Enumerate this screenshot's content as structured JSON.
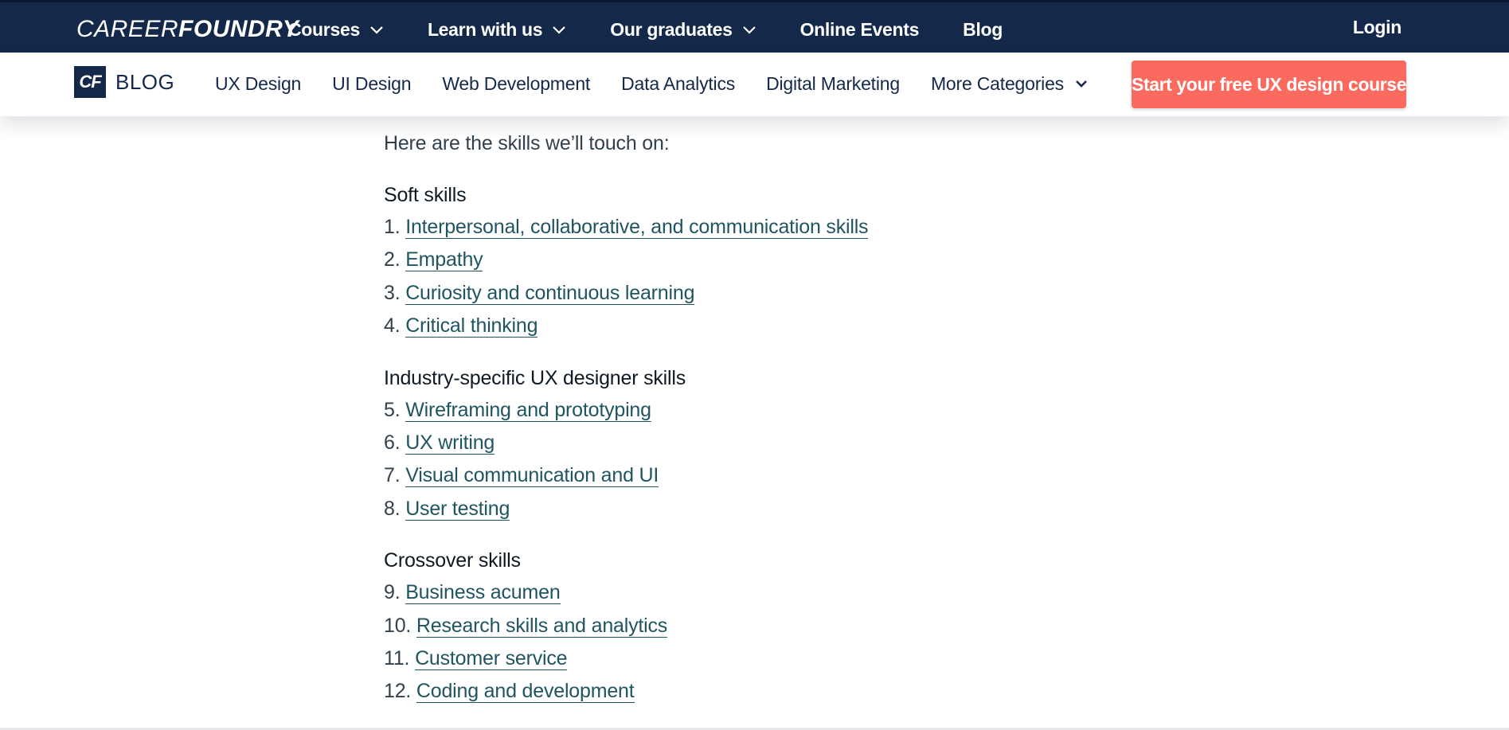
{
  "topbar": {
    "logo_part1": "CAREER",
    "logo_part2": "FOUNDRY",
    "nav": [
      {
        "label": "Courses",
        "dropdown": true
      },
      {
        "label": "Learn with us",
        "dropdown": true
      },
      {
        "label": "Our graduates",
        "dropdown": true
      },
      {
        "label": "Online Events",
        "dropdown": false
      },
      {
        "label": "Blog",
        "dropdown": false
      }
    ],
    "login": "Login"
  },
  "subbar": {
    "badge": "CF",
    "blog_label": "BLOG",
    "categories": [
      "UX Design",
      "UI Design",
      "Web Development",
      "Data Analytics",
      "Digital Marketing",
      "More Categories"
    ],
    "cta": "Start your free UX design course"
  },
  "content": {
    "intro": "Here are the skills we’ll touch on:",
    "sections": [
      {
        "title": "Soft skills",
        "items": [
          {
            "num": "1.",
            "label": "Interpersonal, collaborative, and communication skills"
          },
          {
            "num": "2.",
            "label": "Empathy"
          },
          {
            "num": "3.",
            "label": "Curiosity and continuous learning"
          },
          {
            "num": "4.",
            "label": "Critical thinking"
          }
        ]
      },
      {
        "title": "Industry-specific UX designer skills",
        "items": [
          {
            "num": "5.",
            "label": "Wireframing and prototyping"
          },
          {
            "num": "6.",
            "label": "UX writing"
          },
          {
            "num": "7.",
            "label": "Visual communication and UI"
          },
          {
            "num": "8.",
            "label": "User testing"
          }
        ]
      },
      {
        "title": "Crossover skills",
        "items": [
          {
            "num": "9.",
            "label": "Business acumen"
          },
          {
            "num": "10.",
            "label": "Research skills and analytics"
          },
          {
            "num": "11.",
            "label": "Customer service"
          },
          {
            "num": "12.",
            "label": "Coding and development"
          }
        ]
      }
    ]
  },
  "colors": {
    "navy": "#14294a",
    "cta": "#fa6a5f",
    "link": "#1f5561"
  }
}
